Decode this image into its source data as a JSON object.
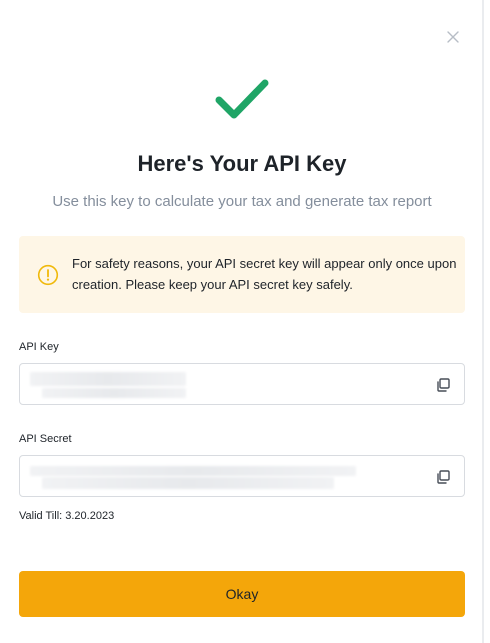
{
  "modal": {
    "title": "Here's Your API Key",
    "subtitle": "Use this key to calculate your tax and generate tax report"
  },
  "notice": {
    "text": "For safety reasons, your API secret key will appear only once upon creation. Please keep your API secret key safely.",
    "icon": "info-circle-icon"
  },
  "api_key": {
    "label": "API Key",
    "value": "",
    "value_hidden": true
  },
  "api_secret": {
    "label": "API Secret",
    "value": "",
    "value_hidden": true
  },
  "valid_till": "Valid Till: 3.20.2023",
  "okay_button": "Okay",
  "colors": {
    "accent": "#f4a60a",
    "success": "#1fa566",
    "notice_bg": "#fef6e6",
    "notice_icon": "#f0b90b",
    "text_primary": "#1e2329",
    "text_secondary": "#848e9c",
    "border": "#d8dbe0"
  },
  "icons": {
    "close": "close-icon",
    "success": "checkmark-icon",
    "copy": "copy-icon"
  }
}
